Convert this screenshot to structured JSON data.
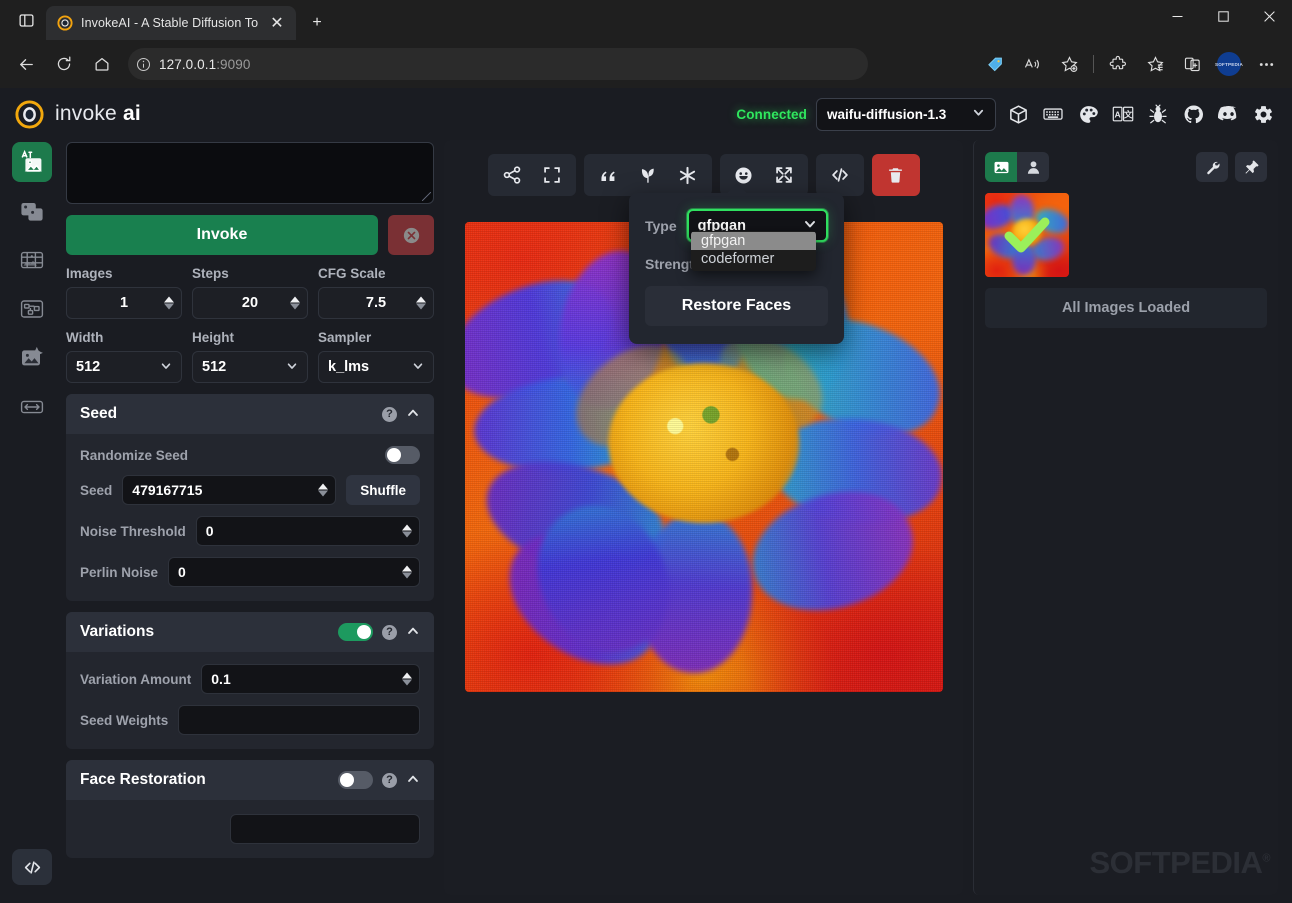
{
  "browser": {
    "tab": {
      "title": "InvokeAI - A Stable Diffusion Too",
      "favicon_name": "invoke-favicon",
      "close_label": "✕"
    },
    "new_tab_label": "+",
    "window_controls": {
      "minimize": "—",
      "maximize": "□",
      "close": "✕"
    },
    "nav": {
      "back": "←",
      "reload": "↻",
      "home": "⌂"
    },
    "address": {
      "host": "127.0.0.1",
      "port": ":9090",
      "info_icon": "info-icon"
    },
    "toolbar_right": [
      "price-tag-icon",
      "read-aloud-icon",
      "add-favorite-icon",
      "extensions-icon",
      "collections-icon",
      "split-screen-icon",
      "profile-avatar",
      "settings-more-icon"
    ],
    "profile_label": "SOFTPEDIA"
  },
  "app": {
    "logo": {
      "name": "invoke",
      "bold": "ai"
    },
    "status": "Connected",
    "model": "waifu-diffusion-1.3",
    "header_icons": [
      "model-manager-icon",
      "keyboard-shortcuts-icon",
      "theme-palette-icon",
      "language-icon",
      "report-bug-icon",
      "github-icon",
      "discord-icon",
      "settings-gear-icon"
    ],
    "rail_items": [
      {
        "name": "text-to-image",
        "active": true
      },
      {
        "name": "image-to-image",
        "active": false
      },
      {
        "name": "unified-canvas",
        "active": false
      },
      {
        "name": "nodes",
        "active": false
      },
      {
        "name": "post-processing",
        "active": false
      },
      {
        "name": "training",
        "active": false
      }
    ],
    "rail_bottom": "console-toggle"
  },
  "options": {
    "prompt_value": "",
    "prompt_placeholder": "",
    "invoke_label": "Invoke",
    "cancel_label": "cancel-icon",
    "numbers": [
      {
        "label": "Images",
        "value": "1"
      },
      {
        "label": "Steps",
        "value": "20"
      },
      {
        "label": "CFG Scale",
        "value": "7.5"
      }
    ],
    "selects": [
      {
        "label": "Width",
        "value": "512"
      },
      {
        "label": "Height",
        "value": "512"
      },
      {
        "label": "Sampler",
        "value": "k_lms"
      }
    ],
    "seed_panel": {
      "title": "Seed",
      "collapsed": false,
      "randomize_label": "Randomize Seed",
      "randomize_on": false,
      "seed_label": "Seed",
      "seed_value": "479167715",
      "shuffle_label": "Shuffle",
      "noise_threshold_label": "Noise Threshold",
      "noise_threshold_value": "0",
      "perlin_label": "Perlin Noise",
      "perlin_value": "0"
    },
    "variations_panel": {
      "title": "Variations",
      "enabled": true,
      "amount_label": "Variation Amount",
      "amount_value": "0.1",
      "weights_label": "Seed Weights",
      "weights_value": ""
    },
    "face_panel": {
      "title": "Face Restoration",
      "enabled": false
    },
    "help_glyph": "?",
    "chevron_glyph": "⌃"
  },
  "viewer": {
    "toolbar_groups": [
      {
        "icons": [
          "share-icon",
          "fullscreen-icon"
        ]
      },
      {
        "icons": [
          "use-prompt-icon",
          "use-seed-icon",
          "use-all-parameters-icon"
        ]
      },
      {
        "icons": [
          "restore-faces-icon",
          "upscale-icon"
        ]
      },
      {
        "icons": [
          "metadata-code-icon"
        ]
      },
      {
        "icons": [
          "delete-trash-icon"
        ],
        "danger": true
      }
    ],
    "popover": {
      "type_label": "Type",
      "type_value": "gfpgan",
      "strength_label": "Strength",
      "restore_label": "Restore Faces",
      "options": [
        "gfpgan",
        "codeformer"
      ],
      "selected_option": "gfpgan",
      "focus_color": "#30e060"
    }
  },
  "gallery": {
    "tabs": [
      {
        "name": "generations-tab",
        "icon": "image-icon",
        "active": true
      },
      {
        "name": "uploads-tab",
        "icon": "person-icon",
        "active": false
      }
    ],
    "actions": [
      {
        "name": "gallery-settings-button",
        "icon": "wrench-icon"
      },
      {
        "name": "pin-gallery-button",
        "icon": "pin-icon"
      }
    ],
    "thumbnail_name": "gallery-thumbnail-selected",
    "selected_check": "check-icon",
    "status": "All Images Loaded",
    "watermark": "SOFTPEDIA",
    "watermark_mark": "®"
  },
  "colors": {
    "accent_green": "#1d7a4c",
    "status_green": "#2fe75e",
    "danger_red": "#c03530",
    "panel_bg": "#23262e",
    "panel_head": "#2c303a",
    "app_bg": "#1a1c22"
  }
}
